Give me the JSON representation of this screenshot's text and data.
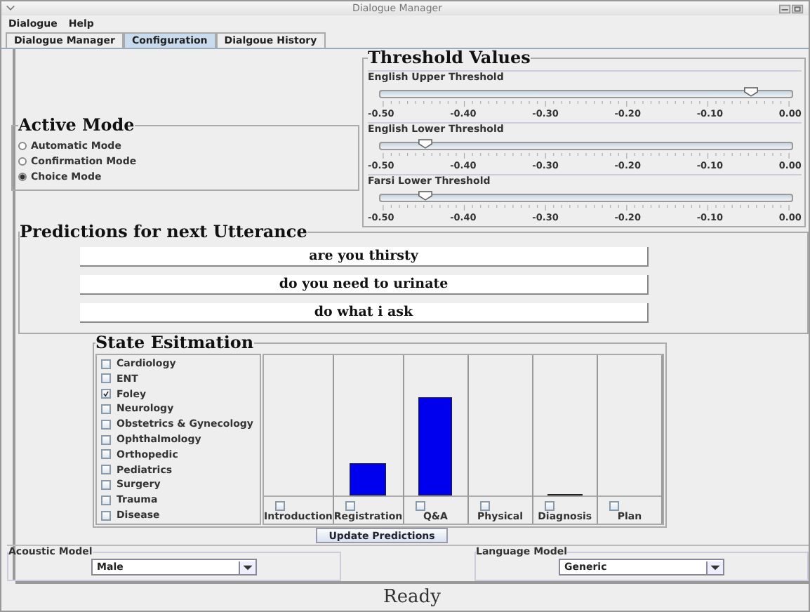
{
  "window": {
    "title": "Dialogue Manager"
  },
  "menu": [
    "Dialogue",
    "Help"
  ],
  "tabs": [
    {
      "label": "Dialogue Manager",
      "selected": false
    },
    {
      "label": "Configuration",
      "selected": true
    },
    {
      "label": "Dialgoue History",
      "selected": false
    }
  ],
  "active_mode": {
    "title": "Active Mode",
    "options": [
      {
        "label": "Automatic Mode",
        "selected": false
      },
      {
        "label": "Confirmation Mode",
        "selected": false
      },
      {
        "label": "Choice Mode",
        "selected": true
      }
    ]
  },
  "thresholds": {
    "title": "Threshold Values",
    "sliders": [
      {
        "label": "English Upper Threshold",
        "level": 0.9,
        "ticks": [
          "-0.50",
          "-0.40",
          "-0.30",
          "-0.20",
          "-0.10",
          "0.00"
        ]
      },
      {
        "label": "English Lower Threshold",
        "level": 0.11,
        "ticks": [
          "-0.50",
          "-0.40",
          "-0.30",
          "-0.20",
          "-0.10",
          "0.00"
        ]
      },
      {
        "label": "Farsi Lower Threshold",
        "level": 0.11,
        "ticks": [
          "-0.50",
          "-0.40",
          "-0.30",
          "-0.20",
          "-0.10",
          "0.00"
        ]
      }
    ]
  },
  "predictions": {
    "title": "Predictions for next Utterance",
    "items": [
      "are you thirsty",
      "do you need to urinate",
      "do what i ask"
    ]
  },
  "state_estimation": {
    "title": "State Esitmation",
    "categories": [
      {
        "label": "Cardiology",
        "checked": false
      },
      {
        "label": "ENT",
        "checked": false
      },
      {
        "label": "Foley",
        "checked": true
      },
      {
        "label": "Neurology",
        "checked": false
      },
      {
        "label": "Obstetrics & Gynecology",
        "checked": false
      },
      {
        "label": "Ophthalmology",
        "checked": false
      },
      {
        "label": "Orthopedic",
        "checked": false
      },
      {
        "label": "Pediatrics",
        "checked": false
      },
      {
        "label": "Surgery",
        "checked": false
      },
      {
        "label": "Trauma",
        "checked": false
      },
      {
        "label": "Disease",
        "checked": false
      }
    ],
    "stages": [
      {
        "label": "Introduction",
        "checked": false
      },
      {
        "label": "Registration",
        "checked": false,
        "level": 0.24
      },
      {
        "label": "Q&A",
        "checked": false,
        "level": 0.72
      },
      {
        "label": "Physical",
        "checked": false
      },
      {
        "label": "Diagnosis",
        "checked": false,
        "level": 0.01
      },
      {
        "label": "Plan",
        "checked": false
      }
    ],
    "button": "Update Predictions"
  },
  "acoustic_model": {
    "title": "Acoustic Model",
    "value": "Male"
  },
  "language_model": {
    "title": "Language Model",
    "value": "Generic"
  },
  "status_bar": "Ready"
}
